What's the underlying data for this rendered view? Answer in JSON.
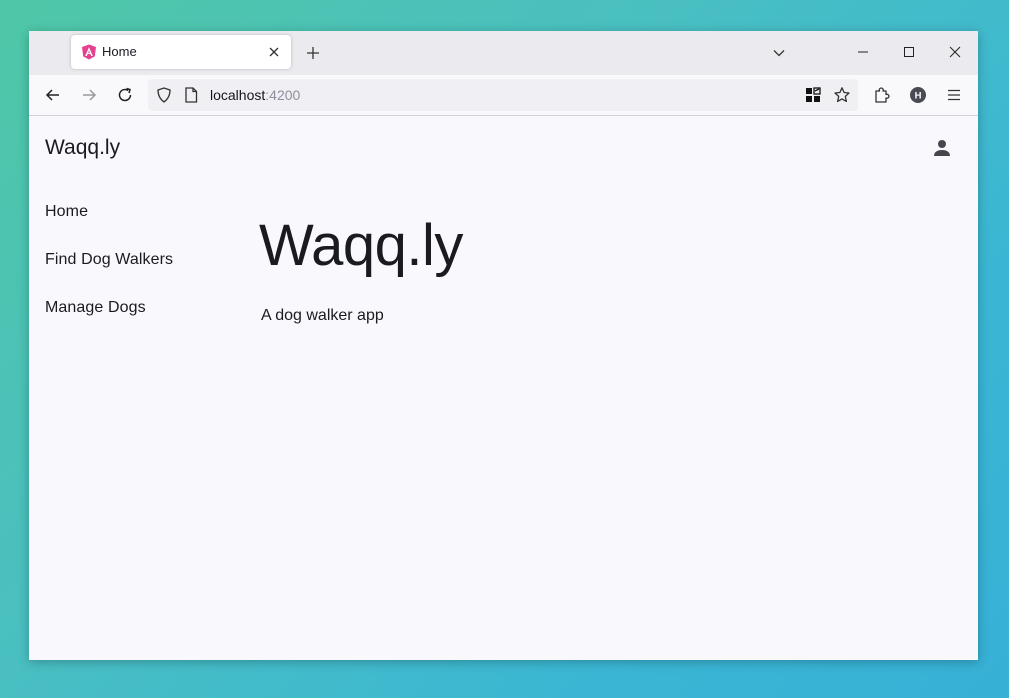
{
  "browser": {
    "tab": {
      "title": "Home"
    },
    "url": {
      "host": "localhost",
      "port": ":4200"
    },
    "icons": {
      "favicon": "angular-icon",
      "tab_close": "close-icon",
      "new_tab": "plus-icon",
      "tab_list": "chevron-down-icon",
      "minimize": "minimize-icon",
      "maximize": "maximize-icon",
      "close_window": "close-icon",
      "back": "arrow-left-icon",
      "forward": "arrow-right-icon",
      "reload": "reload-icon",
      "tracking": "shield-icon",
      "page": "page-icon",
      "qr": "qr-code-icon",
      "bookmark": "star-icon",
      "extensions": "puzzle-icon",
      "profile": "profile-icon",
      "menu": "hamburger-icon"
    },
    "profile_initial": "H"
  },
  "app": {
    "toolbar": {
      "title": "Waqq.ly",
      "account_icon": "person-icon"
    },
    "sidebar": {
      "items": [
        {
          "label": "Home"
        },
        {
          "label": "Find Dog Walkers"
        },
        {
          "label": "Manage Dogs"
        }
      ]
    },
    "main": {
      "title": "Waqq.ly",
      "subtitle": "A dog walker app"
    }
  },
  "colors": {
    "page_background": "#f9f8fd",
    "text": "#1a1b20",
    "favicon_pink": "#e3438e"
  }
}
